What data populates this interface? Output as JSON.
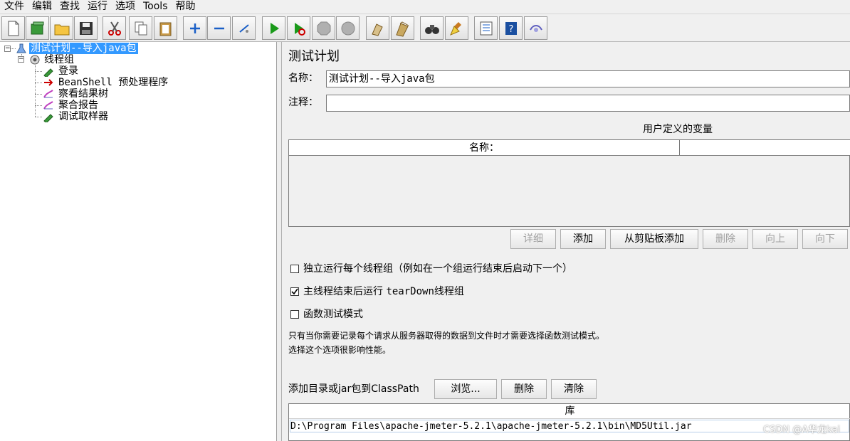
{
  "menu": [
    "文件",
    "编辑",
    "查找",
    "运行",
    "选项",
    "Tools",
    "帮助"
  ],
  "toolbar": {
    "buttons": [
      "new-icon",
      "templates-icon",
      "open-icon",
      "save-icon",
      "cut-icon",
      "copy-icon",
      "paste-icon",
      "expand-icon",
      "collapse-icon",
      "toggle-icon",
      "start-icon",
      "start-no-pause-icon",
      "stop-icon",
      "shutdown-icon",
      "clear-icon",
      "clear-all-icon",
      "search-icon",
      "reset-search-icon",
      "function-helper-icon",
      "help-icon",
      "remote-icon"
    ]
  },
  "tree": {
    "root": "测试计划--导入java包",
    "thread_group": "线程组",
    "children": [
      "登录",
      "BeanShell 预处理程序",
      "察看结果树",
      "聚合报告",
      "调试取样器"
    ]
  },
  "plan": {
    "title": "测试计划",
    "name_label": "名称：",
    "name_value": "测试计划--导入java包",
    "comment_label": "注释：",
    "comment_value": "",
    "variables_title": "用户定义的变量",
    "variables_column": "名称：",
    "variables_column2": "",
    "buttons": {
      "detail": "详细",
      "add": "添加",
      "add_clipboard": "从剪贴板添加",
      "delete": "删除",
      "up": "向上",
      "down": "向下"
    },
    "options": {
      "independent": "独立运行每个线程组（例如在一个组运行结束后启动下一个）",
      "teardown_prefix": "主线程结束后运行 ",
      "teardown_mono": "tearDown",
      "teardown_suffix": "线程组",
      "functional": "函数测试模式",
      "independent_checked": false,
      "teardown_checked": true,
      "functional_checked": false
    },
    "hint_line1": "只有当你需要记录每个请求从服务器取得的数据到文件时才需要选择函数测试模式。",
    "hint_line2": "选择这个选项很影响性能。",
    "classpath_label": "添加目录或jar包到ClassPath",
    "browse": "浏览...",
    "remove": "删除",
    "clear": "清除",
    "lib_header": "库",
    "lib_rows": [
      "D:\\Program Files\\apache-jmeter-5.2.1\\apache-jmeter-5.2.1\\bin\\MD5Util.jar"
    ]
  },
  "watermark": "CSDN @A华龙kai",
  "colors": {
    "selection": "#3399ff",
    "panel_bg": "#f0f0f0"
  }
}
